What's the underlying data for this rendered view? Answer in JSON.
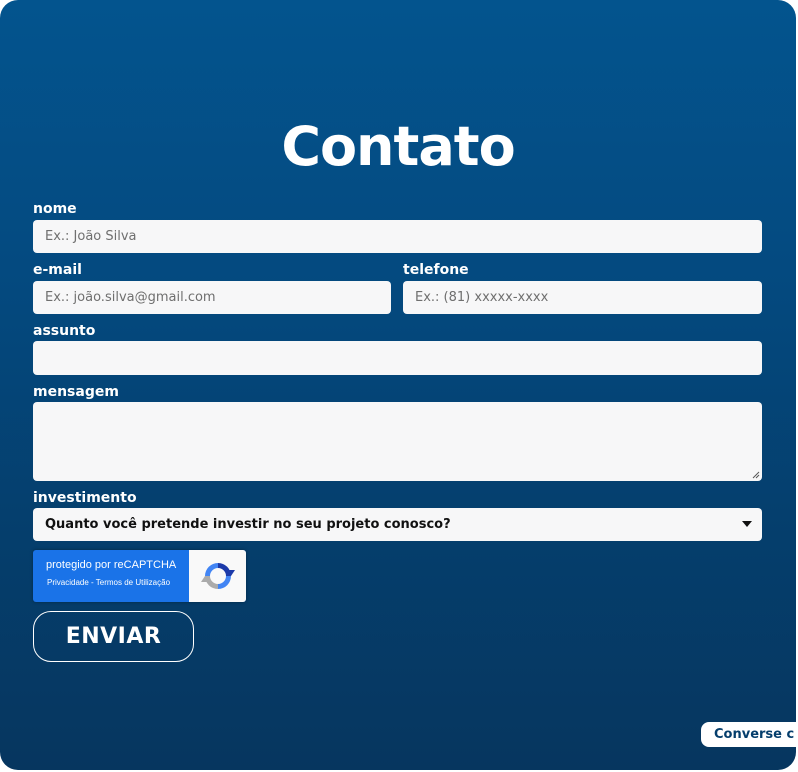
{
  "form": {
    "title": "Contato",
    "nome": {
      "label": "nome",
      "placeholder": "Ex.: João Silva"
    },
    "email": {
      "label": "e-mail",
      "placeholder": "Ex.: joão.silva@gmail.com"
    },
    "telefone": {
      "label": "telefone",
      "placeholder": "Ex.: (81) xxxxx-xxxx"
    },
    "assunto": {
      "label": "assunto",
      "placeholder": ""
    },
    "mensagem": {
      "label": "mensagem",
      "placeholder": ""
    },
    "investimento": {
      "label": "investimento",
      "selected": "Quanto você pretende investir no seu projeto conosco?"
    },
    "recaptcha": {
      "line1": "protegido por reCAPTCHA",
      "line2": "Privacidade - Termos de Utilização"
    },
    "submit_label": "ENVIAR"
  },
  "chat": {
    "label": "Converse c"
  },
  "icons": {
    "recaptcha": "recaptcha-icon",
    "dropdown": "chevron-down-icon",
    "resize": "resize-grip-icon"
  },
  "colors": {
    "background_top": "#03548e",
    "background_bottom": "#06365f",
    "field": "#f7f7f8",
    "recaptcha_blue": "#1a73e8"
  }
}
